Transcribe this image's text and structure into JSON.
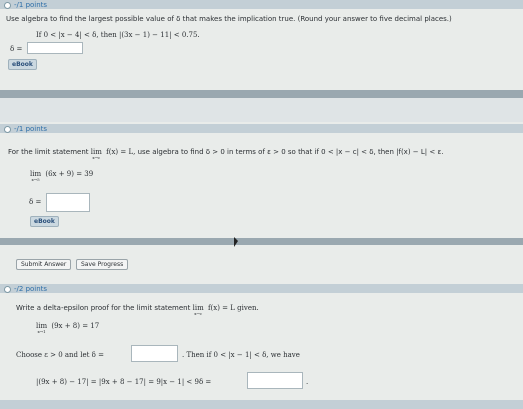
{
  "q1": {
    "points": "-/1 points",
    "instruction": "Use algebra to find the largest possible value of δ that makes the implication true. (Round your answer to five decimal places.)",
    "implication": "If  0 < |x − 4| < δ,  then  |(3x − 1) − 11| < 0.75.",
    "delta_label": "δ =",
    "delta_value": "",
    "ebook": "eBook"
  },
  "q2": {
    "points": "-/1 points",
    "statement_prefix": "For the limit statement",
    "lim_word": "lim",
    "lim_sub": "x→c",
    "statement_fx": "f(x) = L,",
    "statement_rest": "use algebra to find δ > 0 in terms of ε > 0 so that if 0 < |x − c| < δ, then |f(x) − L| < ε.",
    "example_lim_sub": "x→5",
    "example_expr": "(6x + 9) = 39",
    "delta_label": "δ =",
    "delta_value": "",
    "ebook": "eBook"
  },
  "actions": {
    "submit": "Submit Answer",
    "save": "Save Progress"
  },
  "q3": {
    "points": "-/2 points",
    "statement_prefix": "Write a delta-epsilon proof for the limit statement",
    "lim_word": "lim",
    "lim_sub": "x→c",
    "statement_rest": "f(x) = L given.",
    "example_lim_sub": "x→1",
    "example_expr": "(9x + 8) = 17",
    "choose_prefix": "Choose ε > 0 and let δ =",
    "choose_suffix": ". Then if 0 < |x − 1| < δ, we have",
    "proof_line": "|(9x + 8) − 17| = |9x + 8 − 17| = 9|x − 1| < 9δ =",
    "delta_value": "",
    "result_value": "",
    "period": "."
  }
}
